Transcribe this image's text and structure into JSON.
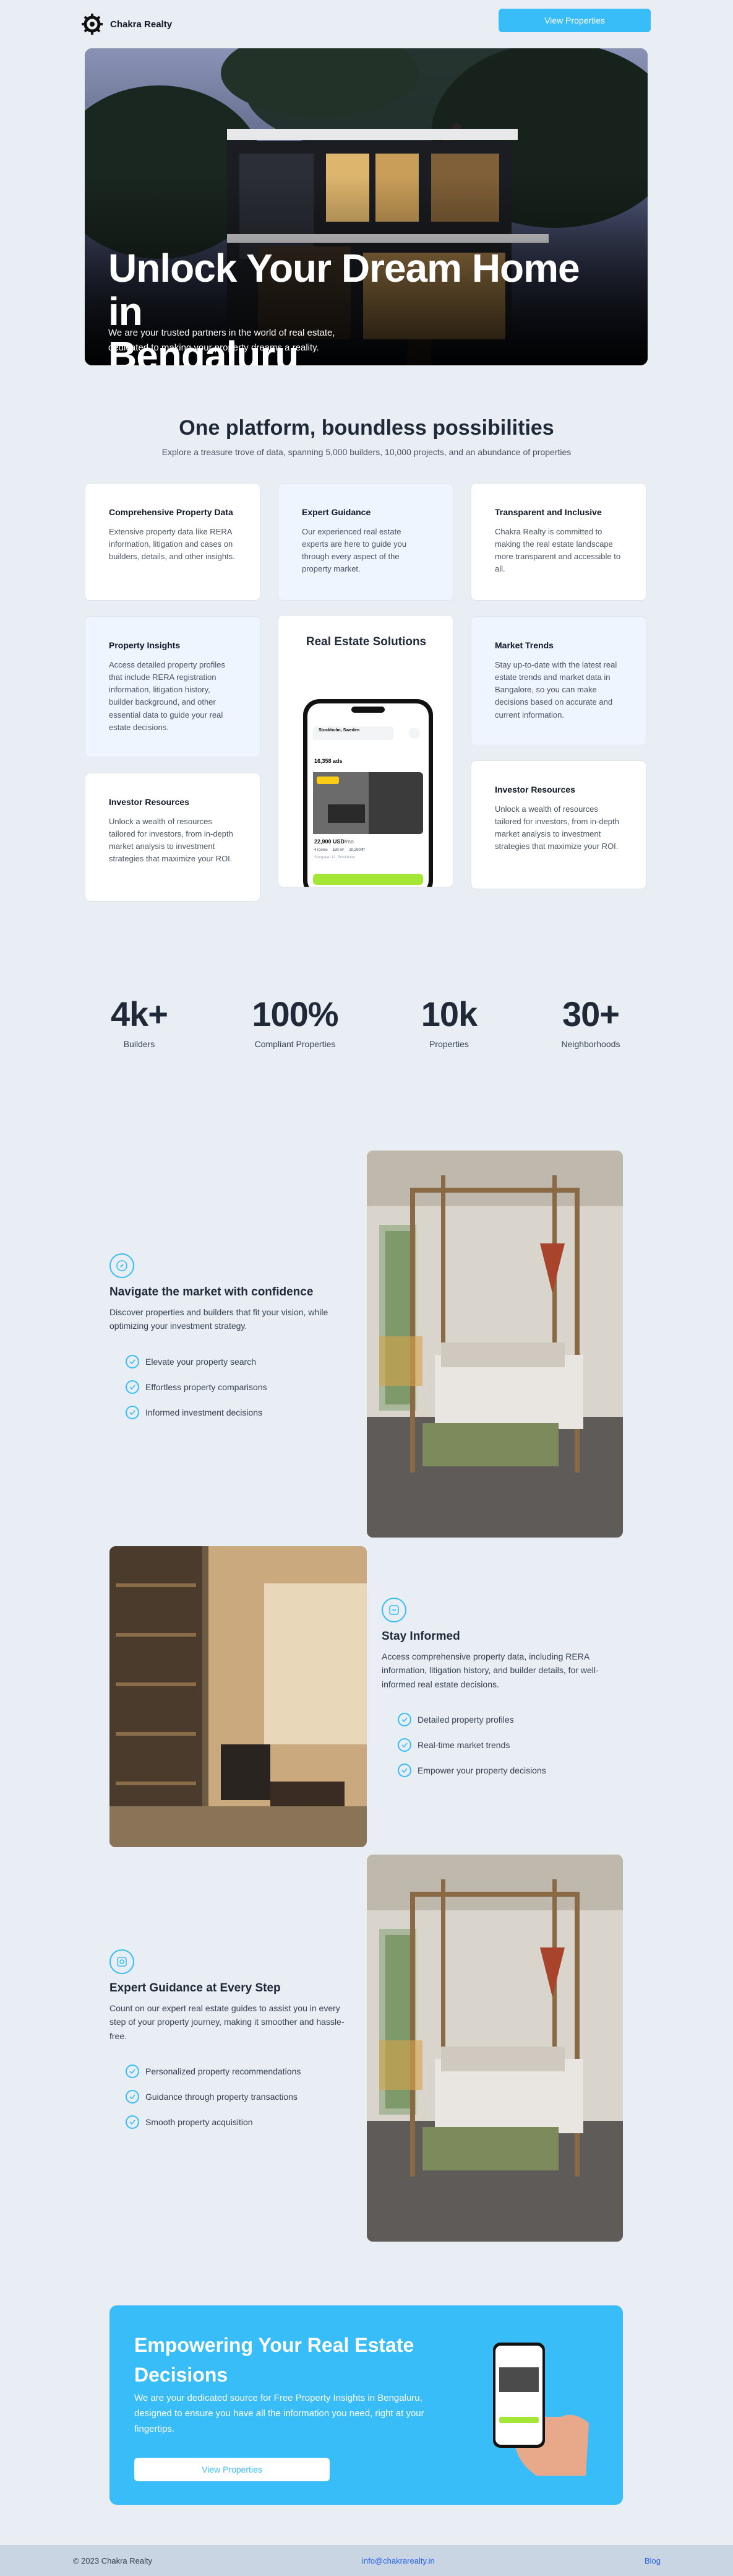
{
  "brand": {
    "name": "Chakra Realty",
    "logo_icon": "chakra-wheel-icon"
  },
  "header": {
    "cta_label": "View Properties"
  },
  "hero": {
    "title_line1": "Unlock Your Dream Home in",
    "title_line2": "Bengaluru",
    "subtitle": "We are your trusted partners in the world of real estate, dedicated to making your property dreams a reality."
  },
  "platform": {
    "title": "One platform, boundless possibilities",
    "subtitle": "Explore a treasure trove of data, spanning 5,000 builders, 10,000 projects, and an abundance of properties",
    "cards": [
      {
        "title": "Comprehensive Property Data",
        "text": "Extensive property data like RERA information, litigation and cases on builders, details, and other insights."
      },
      {
        "title": "Expert Guidance",
        "text": "Our experienced real estate experts are here to guide you through every aspect of the property market."
      },
      {
        "title": "Transparent and Inclusive",
        "text": "Chakra Realty is committed to making the real estate landscape more transparent and accessible to all."
      },
      {
        "title": "Property Insights",
        "text": "Access detailed property profiles that include RERA registration information, litigation history, builder background, and other essential data to guide your real estate decisions."
      },
      {
        "title": "Market Trends",
        "text": "Stay up-to-date with the latest real estate trends and market data in Bangalore, so you can make decisions based on accurate and current information."
      },
      {
        "title": "Investor Resources",
        "text": "Unlock a wealth of resources tailored for investors, from in-depth market analysis to investment strategies that maximize your ROI."
      },
      {
        "title": "Investor Resources",
        "text": "Unlock a wealth of resources tailored for investors, from in-depth market analysis to investment strategies that maximize your ROI."
      }
    ],
    "center_title": "Real Estate Solutions",
    "phone": {
      "location": "Stockholm, Sweden",
      "count": "16,358 ads",
      "price": "22,900 USD",
      "price_suffix": "/mo",
      "meta1": "4 rooms",
      "meta2": "180 m²",
      "meta3": "10,200/ft²",
      "street": "Storgatan 12, Stockholm"
    }
  },
  "stats": [
    {
      "num": "4k+",
      "label": "Builders"
    },
    {
      "num": "100%",
      "label": "Compliant Properties"
    },
    {
      "num": "10k",
      "label": "Properties"
    },
    {
      "num": "30+",
      "label": "Neighborhoods"
    }
  ],
  "features": [
    {
      "icon": "compass-icon",
      "title": "Navigate the market with confidence",
      "text": "Discover properties and builders that fit your vision, while optimizing your investment strategy.",
      "items": [
        "Elevate your property search",
        "Effortless property comparisons",
        "Informed investment decisions"
      ]
    },
    {
      "icon": "info-icon",
      "title": "Stay Informed",
      "text": "Access comprehensive property data, including RERA information, litigation history, and builder details, for well-informed real estate decisions.",
      "items": [
        "Detailed property profiles",
        "Real-time market trends",
        "Empower your property decisions"
      ]
    },
    {
      "icon": "guide-icon",
      "title": "Expert Guidance at Every Step",
      "text": "Count on our expert real estate guides to assist you in every step of your property journey, making it smoother and hassle-free.",
      "items": [
        "Personalized property recommendations",
        "Guidance through property transactions",
        "Smooth property acquisition"
      ]
    }
  ],
  "cta": {
    "title": "Empowering Your Real Estate Decisions",
    "text": "We are your dedicated source for Free Property Insights in Bengaluru, designed to ensure you have all the information you need, right at your fingertips.",
    "button": "View Properties"
  },
  "footer": {
    "copyright": "© 2023 Chakra Realty",
    "email": "info@chakrarealty.in",
    "blog": "Blog"
  },
  "colors": {
    "accent": "#38bdf8",
    "page_bg": "#e9eef4",
    "footer_bg": "#c9d5e2"
  }
}
